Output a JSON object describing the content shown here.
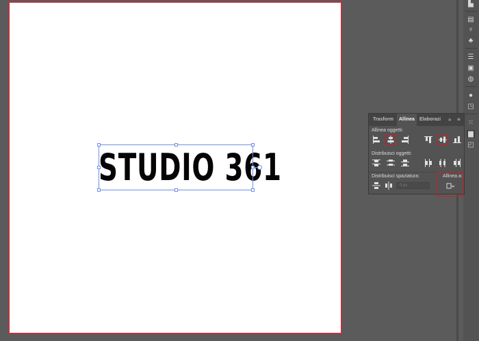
{
  "artboard": {
    "text": "STUDIO 361"
  },
  "panel": {
    "tabs": [
      "Trasform",
      "Allinea",
      "Elaborazi"
    ],
    "collapse_label": "»",
    "sections": {
      "align_objects": "Allinea oggetti:",
      "distribute_objects": "Distribuisci oggetti:",
      "distribute_spacing": "Distribuisci spaziatura:",
      "align_to": "Allinea a:"
    },
    "spacing_value": "0 px"
  },
  "colors": {
    "highlight": "#d01c24",
    "selection": "#6f8fe6",
    "artboard_border": "#b8353c"
  }
}
